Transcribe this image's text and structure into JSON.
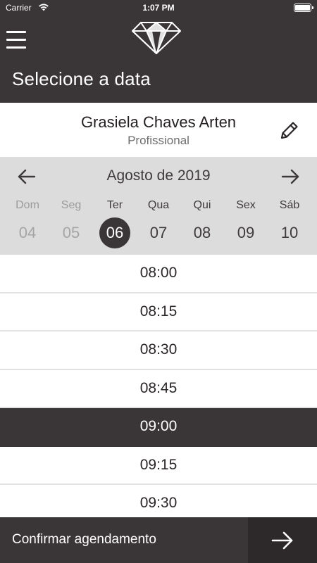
{
  "status_bar": {
    "carrier": "Carrier",
    "time": "1:07 PM",
    "battery_level": 1.0
  },
  "header": {
    "menu_icon": "hamburger-menu-icon",
    "logo_icon": "diamond-logo",
    "title": "Selecione a data"
  },
  "professional": {
    "name": "Grasiela Chaves Arten",
    "role": "Profissional",
    "edit_icon": "pencil-icon"
  },
  "calendar": {
    "month_label": "Agosto de 2019",
    "prev_icon": "arrow-left-icon",
    "next_icon": "arrow-right-icon",
    "weekdays": [
      "Dom",
      "Seg",
      "Ter",
      "Qua",
      "Qui",
      "Sex",
      "Sáb"
    ],
    "days": [
      "04",
      "05",
      "06",
      "07",
      "08",
      "09",
      "10"
    ],
    "selected_day": "06",
    "past_days": [
      "04",
      "05"
    ]
  },
  "time_slots": {
    "items": [
      "08:00",
      "08:15",
      "08:30",
      "08:45",
      "09:00",
      "09:15",
      "09:30"
    ],
    "selected": "09:00"
  },
  "footer": {
    "confirm_label": "Confirmar agendamento",
    "next_icon": "arrow-right-icon"
  },
  "colors": {
    "primary_dark": "#3a3536",
    "calendar_bg": "#dcdcdc",
    "divider": "#e2e2e2",
    "muted_text": "#9a9a9a"
  }
}
